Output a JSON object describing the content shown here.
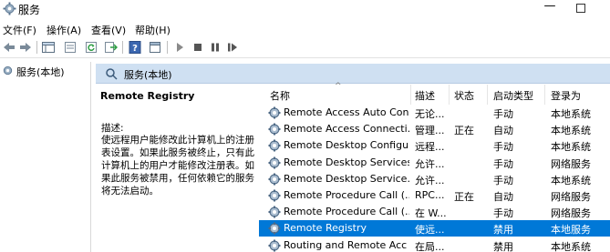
{
  "window": {
    "title": "服务",
    "minimize_glyph": "—"
  },
  "menu": [
    "文件(F)",
    "操作(A)",
    "查看(V)",
    "帮助(H)"
  ],
  "toolbar_icons": [
    "back-arrow-icon",
    "forward-arrow-icon",
    "console-tree-icon",
    "properties-icon",
    "refresh-icon",
    "export-list-icon",
    "help-icon",
    "console-icon",
    "start-service-icon",
    "stop-service-icon",
    "pause-service-icon",
    "restart-service-icon"
  ],
  "tree": {
    "root_label": "服务(本地)"
  },
  "pane": {
    "header": "服务(本地)"
  },
  "description": {
    "title": "Remote Registry",
    "label": "描述:",
    "body": "使远程用户能修改此计算机上的注册表设置。如果此服务被终止，只有此计算机上的用户才能修改注册表。如果此服务被禁用，任何依赖它的服务将无法启动。"
  },
  "list": {
    "sort_indicator": "^",
    "columns": {
      "name": "名称",
      "desc": "描述",
      "status": "状态",
      "startup": "启动类型",
      "logon": "登录为"
    },
    "rows": [
      {
        "name": "Remote Access Auto Con...",
        "desc": "无论...",
        "status": "",
        "startup": "手动",
        "logon": "本地系统",
        "selected": false
      },
      {
        "name": "Remote Access Connecti...",
        "desc": "管理...",
        "status": "正在",
        "startup": "自动",
        "logon": "本地系统",
        "selected": false
      },
      {
        "name": "Remote Desktop Configu...",
        "desc": "远程...",
        "status": "",
        "startup": "手动",
        "logon": "本地系统",
        "selected": false
      },
      {
        "name": "Remote Desktop Services",
        "desc": "允许...",
        "status": "",
        "startup": "手动",
        "logon": "网络服务",
        "selected": false
      },
      {
        "name": "Remote Desktop Service...",
        "desc": "允许...",
        "status": "",
        "startup": "手动",
        "logon": "本地系统",
        "selected": false
      },
      {
        "name": "Remote Procedure Call (...",
        "desc": "RPC...",
        "status": "正在",
        "startup": "自动",
        "logon": "网络服务",
        "selected": false
      },
      {
        "name": "Remote Procedure Call (...",
        "desc": "在 W...",
        "status": "",
        "startup": "手动",
        "logon": "网络服务",
        "selected": false
      },
      {
        "name": "Remote Registry",
        "desc": "使远...",
        "status": "",
        "startup": "禁用",
        "logon": "本地服务",
        "selected": true
      },
      {
        "name": "Routing and Remote Acc",
        "desc": "在局...",
        "status": "",
        "startup": "禁用",
        "logon": "本地系统",
        "selected": false
      }
    ]
  },
  "colors": {
    "selection": "#0078d7",
    "pane_header": "#cfe0f2"
  }
}
